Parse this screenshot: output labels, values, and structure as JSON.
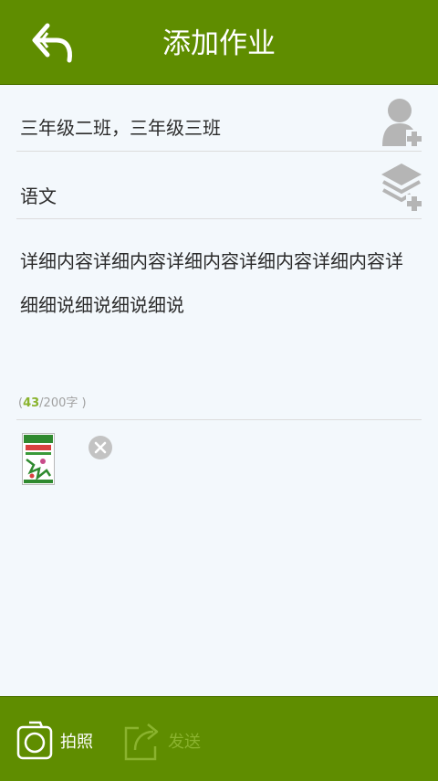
{
  "header": {
    "title": "添加作业",
    "back_icon": "back-arrow-icon"
  },
  "class_row": {
    "value": "三年级二班，三年级三班",
    "icon": "add-contact-icon"
  },
  "subject_row": {
    "value": "语文",
    "icon": "add-layers-icon"
  },
  "content": {
    "line1": "详细内容详细内容详细内容详细内容详细内容详",
    "line2": "细细说细说细说细说"
  },
  "counter": {
    "open": "(",
    "count": "43",
    "rest": "/200字 )"
  },
  "attachment": {
    "thumb_icon": "book-cover-thumbnail",
    "remove_icon": "close-icon"
  },
  "footer": {
    "photo_label": "拍照",
    "send_label": "发送",
    "photo_icon": "camera-icon",
    "send_icon": "share-icon"
  },
  "colors": {
    "brand": "#5f8d00",
    "background": "#f3f8fc",
    "accent": "#8ab32e",
    "disabled": "#8ab32e"
  }
}
